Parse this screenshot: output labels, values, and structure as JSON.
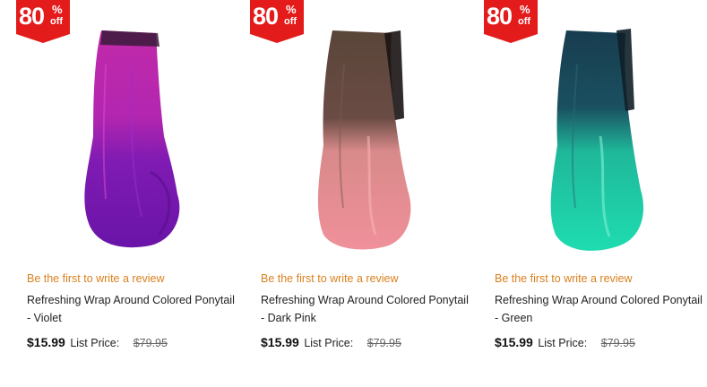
{
  "products": [
    {
      "badge": {
        "number": "80",
        "percent": "%",
        "off": "off"
      },
      "review_link": "Be the first to write a review",
      "title": "Refreshing Wrap Around Colored Ponytail - Violet",
      "price": "$15.99",
      "list_price_label": "List Price:",
      "list_price": "$79.95",
      "image": {
        "top_color": "#c22aa9",
        "bottom_color": "#6a14a8",
        "clip_color": "#3a1a3a"
      }
    },
    {
      "badge": {
        "number": "80",
        "percent": "%",
        "off": "off"
      },
      "review_link": "Be the first to write a review",
      "title": "Refreshing Wrap Around Colored Ponytail - Dark Pink",
      "price": "$15.99",
      "list_price_label": "List Price:",
      "list_price": "$79.95",
      "image": {
        "top_color": "#5a4539",
        "bottom_color": "#f0909a",
        "clip_color": "#1a1413"
      }
    },
    {
      "badge": {
        "number": "80",
        "percent": "%",
        "off": "off"
      },
      "review_link": "Be the first to write a review",
      "title": "Refreshing Wrap Around Colored Ponytail - Green",
      "price": "$15.99",
      "list_price_label": "List Price:",
      "list_price": "$79.95",
      "image": {
        "top_color": "#173d4f",
        "bottom_color": "#1fdcb0",
        "clip_color": "#0f1f28"
      }
    }
  ],
  "colors": {
    "badge_red": "#e41b1b",
    "review_orange": "#d9801e"
  },
  "icons": {
    "badge": "discount-ribbon-icon"
  }
}
